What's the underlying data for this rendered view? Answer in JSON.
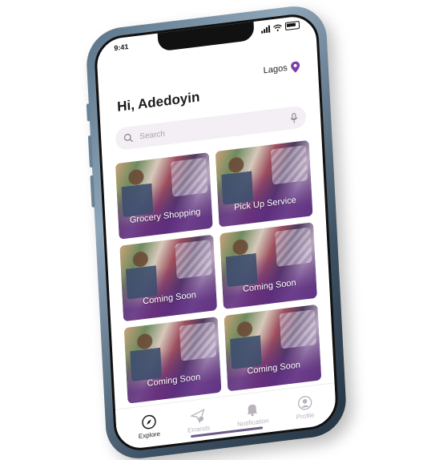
{
  "status": {
    "time": "9:41"
  },
  "header": {
    "location": "Lagos",
    "greeting": "Hi, Adedoyin"
  },
  "search": {
    "placeholder": "Search"
  },
  "services": [
    {
      "label": "Grocery Shopping"
    },
    {
      "label": "Pick Up Service"
    },
    {
      "label": "Coming Soon"
    },
    {
      "label": "Coming Soon"
    },
    {
      "label": "Coming Soon"
    },
    {
      "label": "Coming Soon"
    }
  ],
  "nav": {
    "explore": "Explore",
    "errands": "Errands",
    "notification": "Notification",
    "profile": "Profile"
  },
  "colors": {
    "accent": "#7b3fa6",
    "search_bg": "#f3eff4"
  }
}
